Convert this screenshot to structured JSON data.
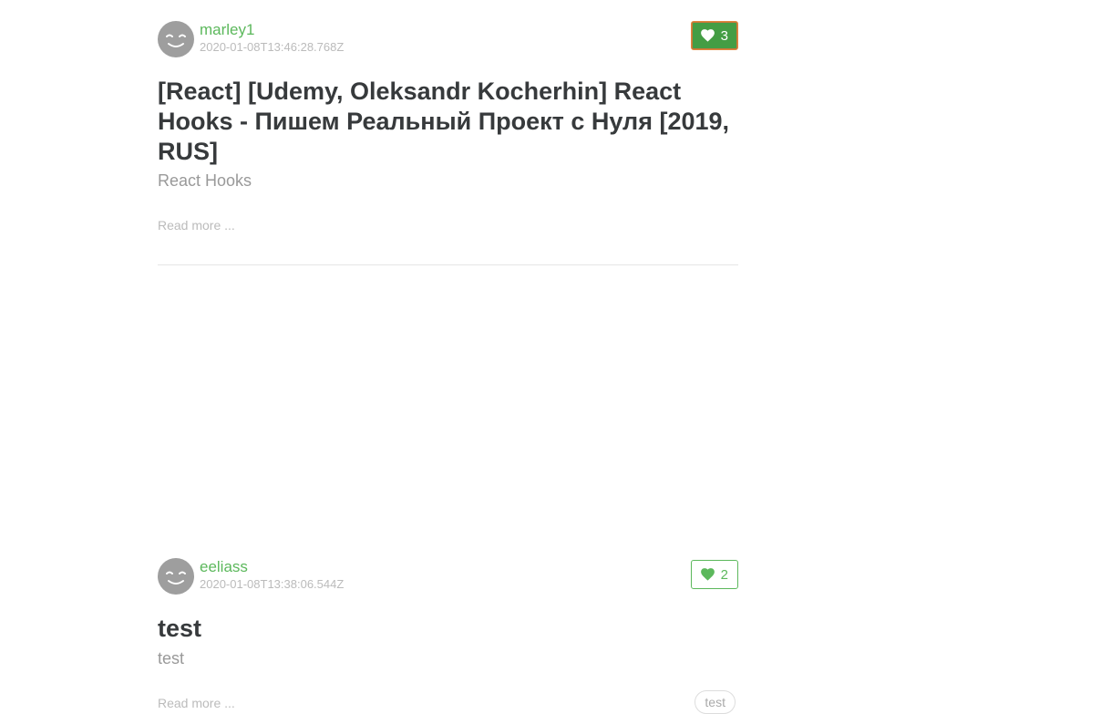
{
  "articles": [
    {
      "author": "marley1",
      "date": "2020-01-08T13:46:28.768Z",
      "favorites_count": "3",
      "favorited": true,
      "title": "[React] [Udemy, Oleksandr Kocherhin] React Hooks - Пишем Реальный Проект с Нуля [2019, RUS]",
      "description": "React Hooks",
      "read_more": "Read more ...",
      "tags": []
    },
    {
      "author": "eeliass",
      "date": "2020-01-08T13:38:06.544Z",
      "favorites_count": "2",
      "favorited": false,
      "title": "test",
      "description": "test",
      "read_more": "Read more ...",
      "tags": [
        "test"
      ]
    }
  ],
  "icons": {
    "avatar": "smiley-face-icon",
    "favorite": "heart-icon"
  },
  "colors": {
    "accent": "#5cb85c",
    "accent_active": "#449d44",
    "text": "#373a3c",
    "muted": "#bbbbbb"
  }
}
